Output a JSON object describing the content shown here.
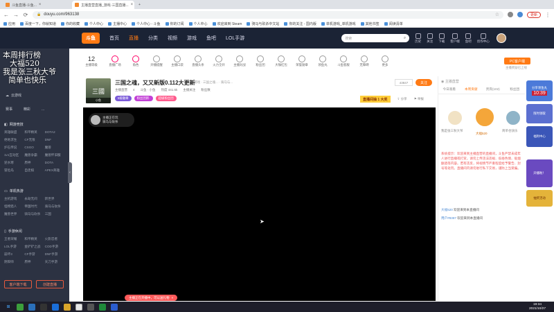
{
  "browser": {
    "tabs": [
      {
        "title": "斗鱼直播-斗鱼..."
      },
      {
        "title": "主播直营直播_游戏·三国直播..."
      },
      {
        "title": "..."
      }
    ],
    "new_tab": "+",
    "url": "douyu.com/963138",
    "update_label": "更新",
    "bookmarks": [
      "应用",
      "百度一下，你就知道",
      "你的收藏",
      "个人中心",
      "主播中心",
      "个人中心 - 斗鱼",
      "你的订阅",
      "个人中心",
      "欢迎来到 Steam",
      "骑马与砍杀中文站",
      "你的关注 - 国内版",
      "单机游戏_单机游戏",
      "其他书签",
      "阅读清单"
    ]
  },
  "topnav": {
    "logo": "斗鱼",
    "items": [
      "首页",
      "直播",
      "分类",
      "视频",
      "游戏",
      "鱼吧",
      "LOL手游"
    ],
    "search_placeholder": "搜索",
    "icons": [
      "历史",
      "关注",
      "下载",
      "客户端",
      "鱼吧",
      "创作中心"
    ]
  },
  "sidebar": {
    "overlay": [
      "本周排行榜",
      "大福520",
      "我是张三秋大爷",
      "简单也快乐"
    ],
    "items_top": [
      "云游戏"
    ],
    "row_icons": [
      "赛事",
      "精彩",
      "..."
    ],
    "sections": [
      {
        "title": "网游竞技",
        "items": [
          "英雄联盟",
          "和平精英",
          "DOTA2",
          "绝地求生",
          "CF无限",
          "DNF",
          "炉石传说",
          "CSGO",
          "魔兽",
          "1v1互动区",
          "魔兽争霸",
          "魔兽怀旧服",
          "逆水寒",
          "原神",
          "DOTA",
          "冒险岛",
          "自走棋",
          "APEX英雄"
        ]
      },
      {
        "title": "单机热游",
        "items": [
          "主机游戏",
          "永劫无间",
          "新世界",
          "怪物猎人",
          "帝国时代",
          "骑马与砍杀",
          "魔兽世界",
          "骑马与砍杀",
          "三国"
        ]
      },
      {
        "title": "手游休闲",
        "items": [
          "王者荣耀",
          "和平精英",
          "火影忍者",
          "LOL手游",
          "金铲铲之战",
          "COD手游",
          "崩坏3",
          "CF手游",
          "DNF手游",
          "阴阳师",
          "原神",
          "天刀手游"
        ]
      }
    ],
    "btn_left": "客户端下载",
    "btn_right": "创建直播"
  },
  "toolbar": {
    "level": "12",
    "level_label": "主播等级",
    "items": [
      "直播广场",
      "角色",
      "开播提醒",
      "主播口袋",
      "直播头条",
      "火力全开",
      "主播对战",
      "粉丝团",
      "大咖红包",
      "荣誉勋章",
      "领鱼丸",
      "斗鱼客服",
      "无障碍",
      "更多"
    ],
    "pc_btn": "PC客户端",
    "pc_sub": "主播奖励已上线"
  },
  "room": {
    "avatar_text": "三國",
    "avatar_tag": "小鱼",
    "title": "三国之魂，又又新版0.112大更新",
    "tags": "游戏 · 三国之魂... · 骑马与...",
    "meta": [
      "主播直营",
      "4",
      "斗鱼 · 小鱼",
      "热度 441.5k",
      "主播关注",
      "粉丝数"
    ],
    "badges": [
      {
        "text": "5级徽章",
        "color": "#7b5ad9"
      },
      {
        "text": "粉丝团新·",
        "color": "#c23fd6"
      },
      {
        "text": "超级粉丝团",
        "color": "#ff5a8c"
      }
    ],
    "slogan": "直播间抽 1 大奖",
    "share": "分享",
    "report": "举报",
    "follow_count": "43847",
    "follow_btn": "关注"
  },
  "player": {
    "anchor_name": "主播正在玩",
    "anchor_game": "骑马与砍杀",
    "bottom_tip": "主播正在开播中，可以送礼物"
  },
  "rightpanel": {
    "tabs": [
      "今日观看",
      "本周贡献",
      "贵宾(102)",
      "粉丝团"
    ],
    "rank_names": [
      "我是张三秋大爷",
      "大福520",
      "简单也快乐"
    ],
    "system_msg": "系统提示：欢迎来到主播直营的直播间，斗鱼严禁未成年人进行直播或打赏，请勿上传违法违规、低俗色情、吸烟酗酒等内容。若有违反，将视情节严重程度给予警告、封号等处罚。直播间内请勿进行私下交易，谨防上当受骗。",
    "chat": [
      {
        "user": "大福520",
        "text": "欢迎来到本直播间"
      },
      {
        "user": "用户#8387",
        "text": "欢迎来到本直播间"
      }
    ]
  },
  "activity": {
    "boxes": [
      "分享领鱼丸",
      "10:39",
      "限时领取",
      "福利中心",
      "开播啦！",
      "抽奖活动",
      "福利"
    ]
  },
  "taskbar": {
    "time": "19:34",
    "date": "2021/10/27"
  }
}
